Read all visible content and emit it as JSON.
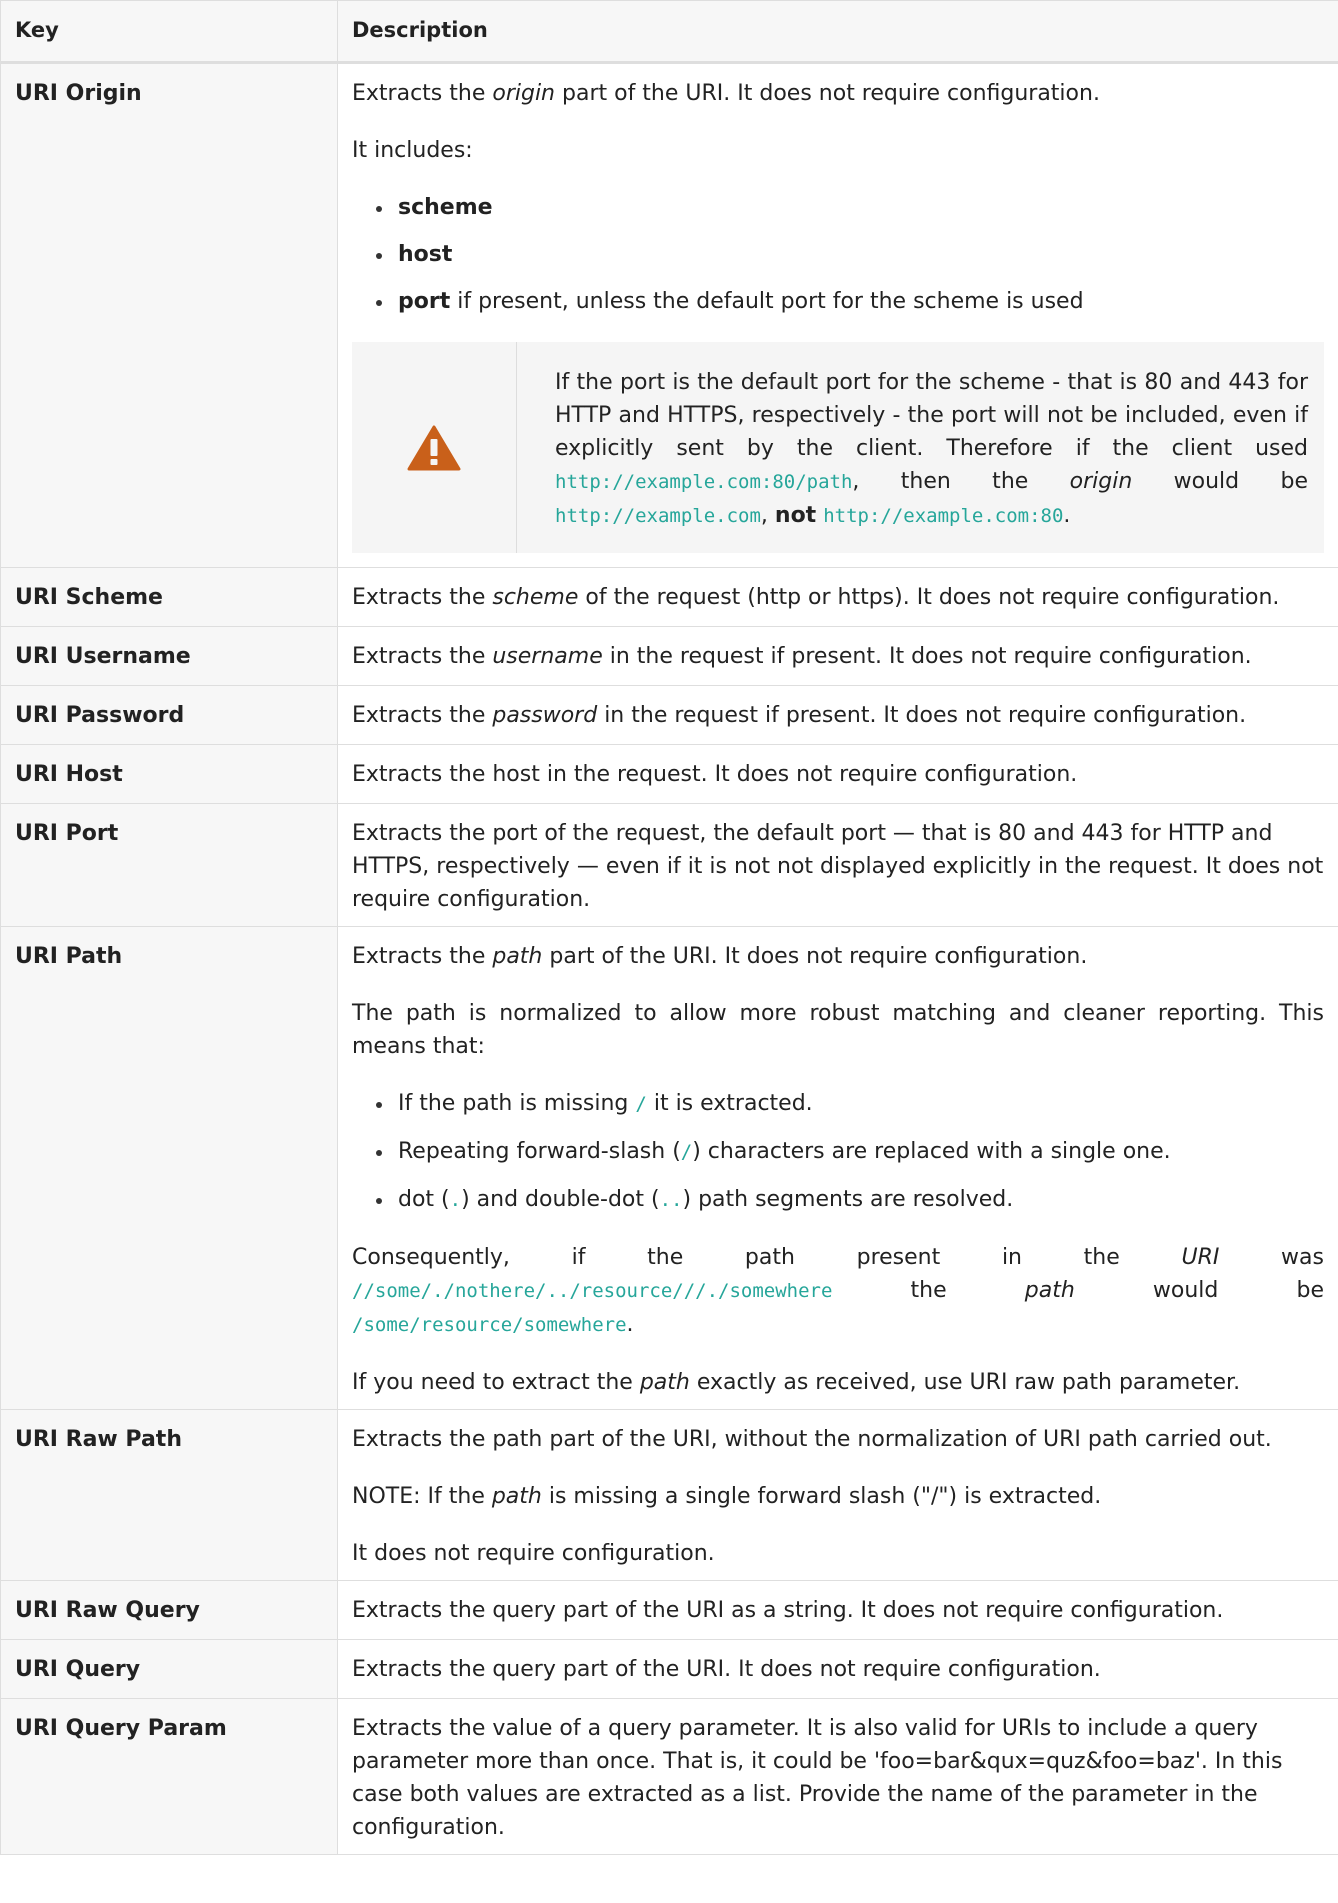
{
  "table": {
    "headers": {
      "key": "Key",
      "description": "Description"
    },
    "rows": {
      "origin": {
        "key": "URI Origin",
        "d1_pre": "Extracts the ",
        "d1_em": "origin",
        "d1_post": " part of the URI. It does not require configuration.",
        "includes": "It includes:",
        "li_scheme": "scheme",
        "li_host": "host",
        "li_port_b": "port",
        "li_port_rest": " if present, unless the default port for the scheme is used",
        "warn_1": "If the port is the default port for the scheme - that is 80 and 443 for HTTP and HTTPS, respectively - the port will not be included, even if explicitly sent by the client. Therefore if the client used ",
        "warn_code1": "http://example.com:80/path",
        "warn_2": ", then the ",
        "warn_em": "origin",
        "warn_3": " would be ",
        "warn_code2": "http://example.com",
        "warn_4": ", ",
        "warn_not": "not",
        "warn_5": " ",
        "warn_code3": "http://example.com:80",
        "warn_6": "."
      },
      "scheme": {
        "key": "URI Scheme",
        "pre": "Extracts the ",
        "em": "scheme",
        "post": " of the request (http or https). It does not require configuration."
      },
      "username": {
        "key": "URI Username",
        "pre": "Extracts the ",
        "em": "username",
        "post": " in the request if present. It does not require configuration."
      },
      "password": {
        "key": "URI Password",
        "pre": "Extracts the ",
        "em": "password",
        "post": " in the request if present. It does not require configuration."
      },
      "host": {
        "key": "URI Host",
        "text": "Extracts the host in the request. It does not require configuration."
      },
      "port": {
        "key": "URI Port",
        "text": "Extracts the port of the request, the default port — that is 80 and 443 for HTTP and HTTPS, respectively — even if it is not not displayed explicitly in the request. It does not require configuration."
      },
      "path": {
        "key": "URI Path",
        "p1_pre": "Extracts the ",
        "p1_em": "path",
        "p1_post": " part of the URI. It does not require configuration.",
        "p2": "The path is normalized to allow more robust matching and cleaner reporting. This means that:",
        "li1_pre": "If the path is missing ",
        "li1_code": "/",
        "li1_post": " it is extracted.",
        "li2_pre": "Repeating forward-slash (",
        "li2_code": "/",
        "li2_post": ") characters are replaced with a single one.",
        "li3_pre": "dot (",
        "li3_code1": ".",
        "li3_mid": ") and double-dot (",
        "li3_code2": "..",
        "li3_post": ") path segments are resolved.",
        "p3_pre": "Consequently, if the path present in the ",
        "p3_em1": "URI",
        "p3_mid1": " was ",
        "p3_code1": "//some/./nothere/../resource///./somewhere",
        "p3_mid2": " the ",
        "p3_em2": "path",
        "p3_mid3": " would be ",
        "p3_code2": "/some/resource/somewhere",
        "p3_post": ".",
        "p4_pre": "If you need to extract the ",
        "p4_em": "path",
        "p4_post": " exactly as received, use URI raw path parameter."
      },
      "raw_path": {
        "key": "URI Raw Path",
        "p1": "Extracts the path part of the URI, without the normalization of URI path carried out.",
        "p2_pre": "NOTE: If the ",
        "p2_em": "path",
        "p2_post": " is missing a single forward slash (\"/\") is extracted.",
        "p3": "It does not require configuration."
      },
      "raw_query": {
        "key": "URI Raw Query",
        "text": "Extracts the query part of the URI as a string. It does not require configuration."
      },
      "query": {
        "key": "URI Query",
        "text": "Extracts the query part of the URI. It does not require configuration."
      },
      "query_param": {
        "key": "URI Query Param",
        "text": "Extracts the value of a query parameter. It is also valid for URIs to include a query parameter more than once. That is, it could be 'foo=bar&qux=quz&foo=baz'. In this case both values are extracted as a list. Provide the name of the parameter in the configuration."
      }
    }
  },
  "icons": {
    "warning": "warning-icon",
    "warning_color": "#c9601a"
  }
}
